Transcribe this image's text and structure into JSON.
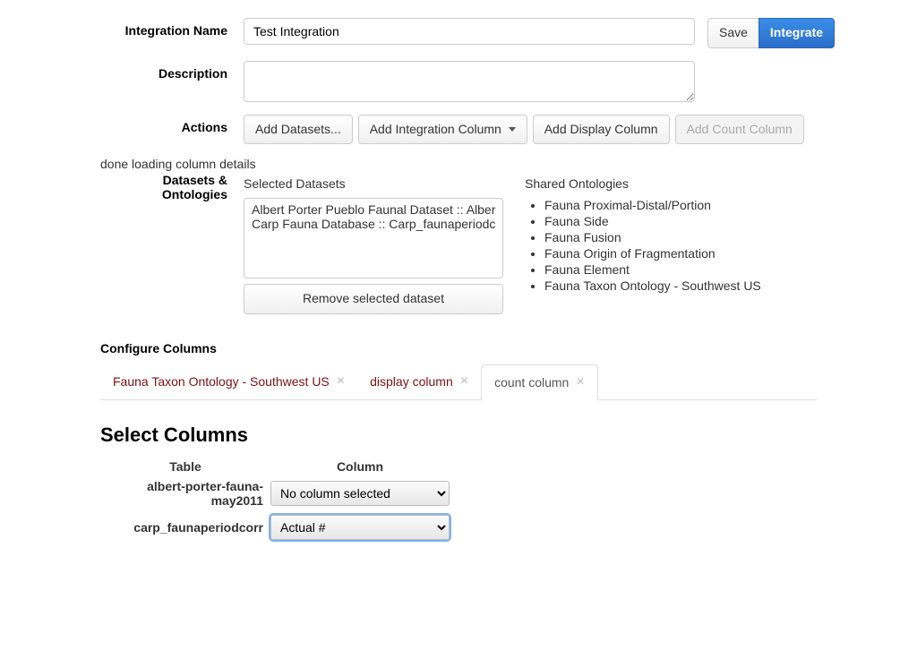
{
  "labels": {
    "integration_name": "Integration Name",
    "description": "Description",
    "actions": "Actions",
    "datasets_ontologies": "Datasets & Ontologies"
  },
  "integration_name_value": "Test Integration",
  "description_value": "",
  "buttons": {
    "save": "Save",
    "integrate": "Integrate",
    "add_datasets": "Add Datasets...",
    "add_integration_column": "Add Integration Column",
    "add_display_column": "Add Display Column",
    "add_count_column": "Add Count Column",
    "remove_selected": "Remove selected dataset"
  },
  "status": "done loading column details",
  "selected_datasets_heading": "Selected Datasets",
  "shared_ontologies_heading": "Shared Ontologies",
  "datasets": [
    "Albert Porter Pueblo Faunal Dataset :: Albert-",
    "Carp Fauna Database :: Carp_faunaperiodcorr"
  ],
  "ontologies": [
    "Fauna Proximal-Distal/Portion",
    "Fauna Side",
    "Fauna Fusion",
    "Fauna Origin of Fragmentation",
    "Fauna Element",
    "Fauna Taxon Ontology - Southwest US"
  ],
  "configure_columns_heading": "Configure Columns",
  "tabs": [
    {
      "label": "Fauna Taxon Ontology - Southwest US",
      "active": false
    },
    {
      "label": "display column",
      "active": false
    },
    {
      "label": "count column",
      "active": true
    }
  ],
  "select_columns_heading": "Select Columns",
  "columns_table": {
    "headers": {
      "table": "Table",
      "column": "Column"
    },
    "rows": [
      {
        "table": "albert-porter-fauna-may2011",
        "selected": "No column selected",
        "focused": false
      },
      {
        "table": "carp_faunaperiodcorr",
        "selected": "Actual #",
        "focused": true
      }
    ],
    "options": [
      "No column selected",
      "Actual #"
    ]
  }
}
